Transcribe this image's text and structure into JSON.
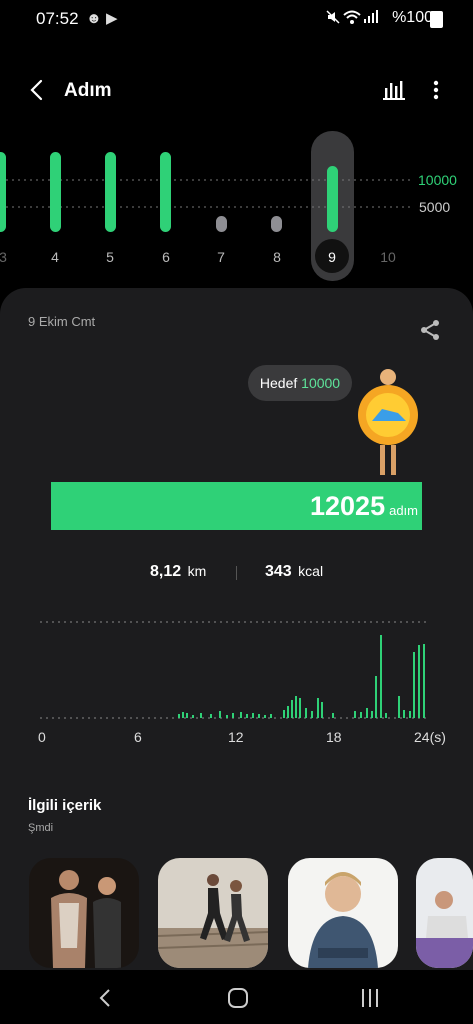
{
  "status_bar": {
    "time": "07:52",
    "battery_text": "%100"
  },
  "header": {
    "title": "Adım"
  },
  "weekly": {
    "days": [
      "3",
      "4",
      "5",
      "6",
      "7",
      "8",
      "9",
      "10"
    ],
    "selected_day": "9",
    "goal_line_label": "10000",
    "mid_line_label": "5000",
    "colors": {
      "active": "#2fd177",
      "inactive": "#8e8e93"
    }
  },
  "detail": {
    "date": "9 Ekim Cmt",
    "goal_label": "Hedef",
    "goal_value": "10000",
    "steps_value": "12025",
    "steps_unit": "adım",
    "distance_value": "8,12",
    "distance_unit": "km",
    "calories_value": "343",
    "calories_unit": "kcal"
  },
  "hourly": {
    "x_labels": [
      "0",
      "6",
      "12",
      "18",
      "24(s)"
    ]
  },
  "related": {
    "title": "İlgili içerik",
    "subtitle": "Şmdi"
  },
  "colors": {
    "accent": "#2fd177",
    "card": "#1c1c1e"
  }
}
